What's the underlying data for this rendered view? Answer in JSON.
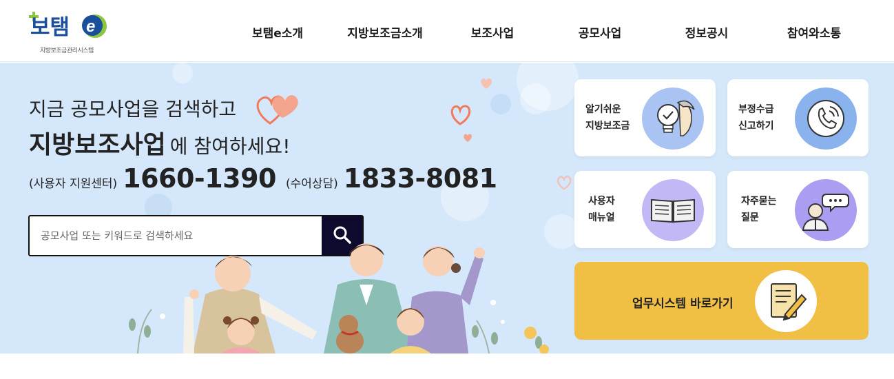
{
  "logo": {
    "main": "보탬",
    "e": "e",
    "sub": "지방보조금관리시스템"
  },
  "nav": [
    {
      "label": "보탬e소개"
    },
    {
      "label": "지방보조금소개"
    },
    {
      "label": "보조사업"
    },
    {
      "label": "공모사업"
    },
    {
      "label": "정보공시"
    },
    {
      "label": "참여와소통"
    }
  ],
  "hero": {
    "line1": "지금 공모사업을 검색하고",
    "line2_strong": "지방보조사업",
    "line2_rest": "에 참여하세요!",
    "user_center_label": "(사용자 지원센터)",
    "user_center_phone": "1660-1390",
    "sign_label": "(수어상담)",
    "sign_phone": "1833-8081"
  },
  "search": {
    "placeholder": "공모사업 또는 키워드로 검색하세요"
  },
  "cards": [
    {
      "label": "알기쉬운\n지방보조금",
      "icon": "lightbulb-person-icon",
      "color": "#a9c4f2"
    },
    {
      "label": "부정수급\n신고하기",
      "icon": "phone-call-icon",
      "color": "#8ab3ee"
    },
    {
      "label": "사용자\n매뉴얼",
      "icon": "open-book-icon",
      "color": "#c2b8f5"
    },
    {
      "label": "자주묻는\n질문",
      "icon": "speech-person-icon",
      "color": "#ab9df2"
    }
  ],
  "biz": {
    "label": "업무시스템 바로가기",
    "icon": "document-pen-icon",
    "color": "#f2bf45"
  },
  "colors": {
    "hero_bg": "#d5e8fb",
    "search_button": "#0d0a2e",
    "logo_green": "#8cc63f",
    "logo_blue": "#1a4f9c"
  }
}
